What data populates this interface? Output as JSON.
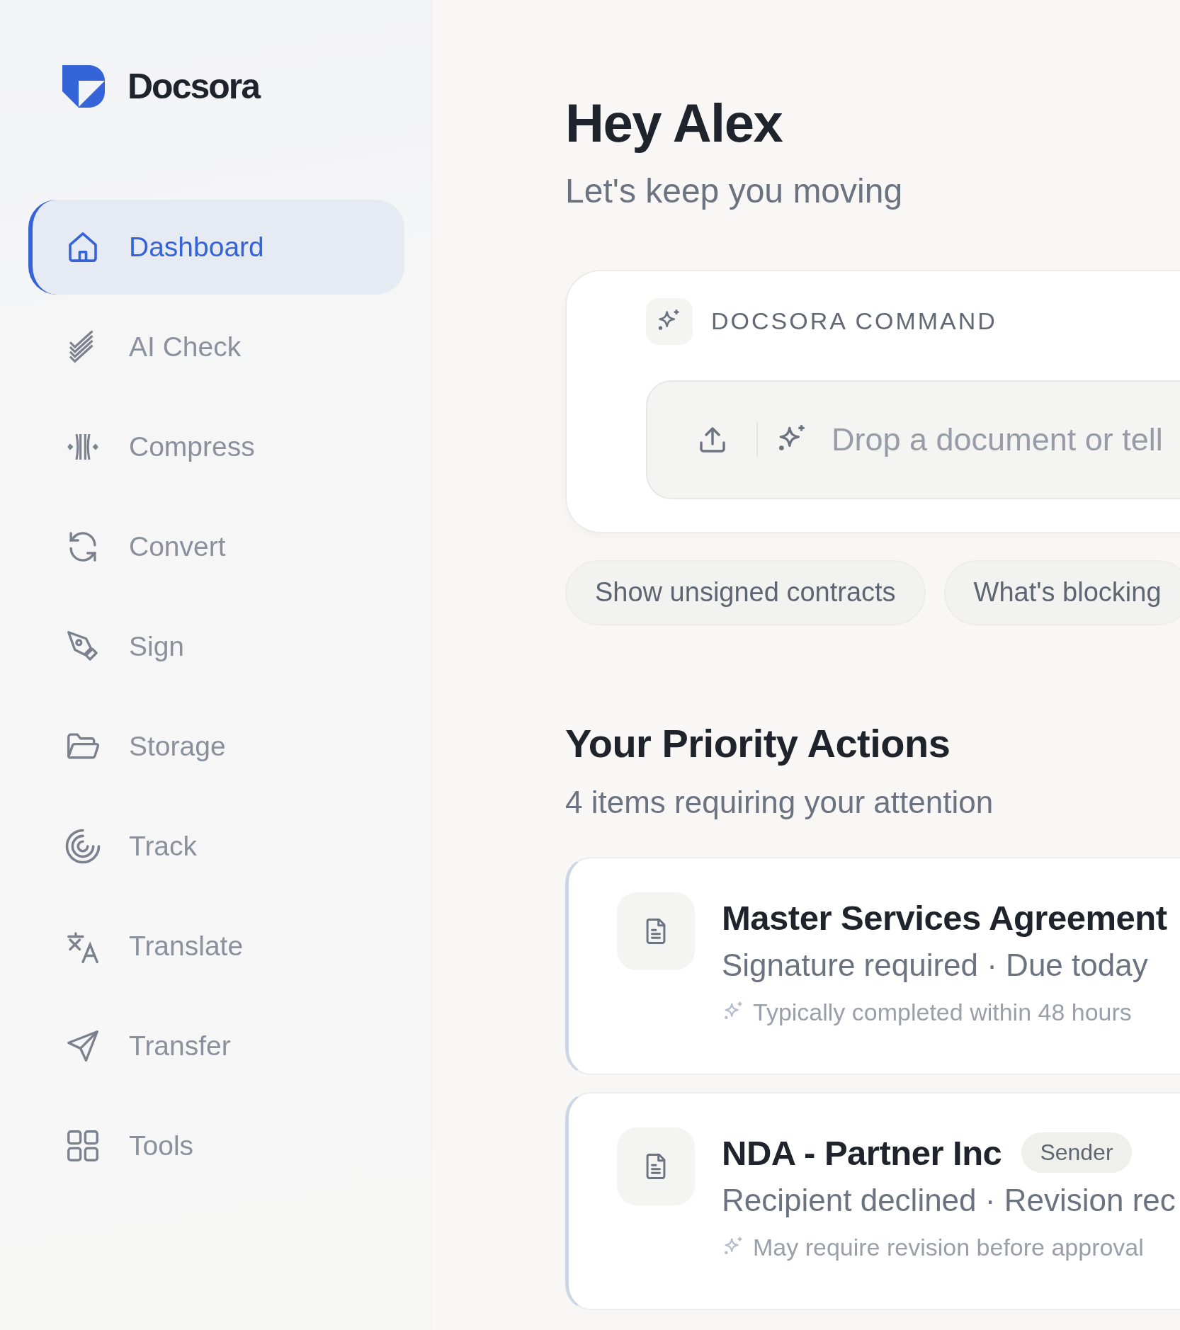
{
  "brand": {
    "name": "Docsora"
  },
  "nav": [
    {
      "label": "Dashboard",
      "selected": true
    },
    {
      "label": "AI Check",
      "selected": false
    },
    {
      "label": "Compress",
      "selected": false
    },
    {
      "label": "Convert",
      "selected": false
    },
    {
      "label": "Sign",
      "selected": false
    },
    {
      "label": "Storage",
      "selected": false
    },
    {
      "label": "Track",
      "selected": false
    },
    {
      "label": "Translate",
      "selected": false
    },
    {
      "label": "Transfer",
      "selected": false
    },
    {
      "label": "Tools",
      "selected": false
    }
  ],
  "greeting": {
    "title": "Hey Alex",
    "subtitle": "Let's keep you moving"
  },
  "command": {
    "label": "DOCSORA COMMAND",
    "placeholder": "Drop a document or tell"
  },
  "suggestions": [
    "Show unsigned contracts",
    "What's blocking"
  ],
  "priority": {
    "title": "Your Priority Actions",
    "subtitle": "4 items requiring your attention",
    "items": [
      {
        "title": "Master Services Agreement",
        "status": "Signature required · Due today",
        "hint": "Typically completed within 48 hours"
      },
      {
        "title": "NDA - Partner Inc",
        "tag": "Sender",
        "status": "Recipient declined · Revision rec",
        "hint": "May require revision before approval"
      }
    ]
  }
}
